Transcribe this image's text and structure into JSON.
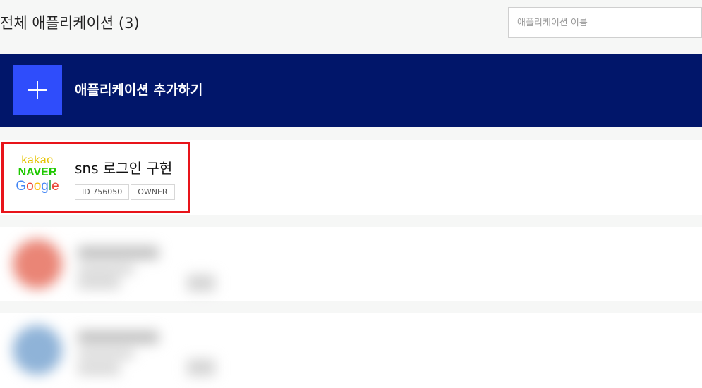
{
  "header": {
    "title": "전체 애플리케이션 (3)",
    "search_placeholder": "애플리케이션 이름"
  },
  "add_app": {
    "label": "애플리케이션 추가하기",
    "icon": "plus-icon"
  },
  "apps": [
    {
      "name": "sns 로그인 구현",
      "logo": {
        "kakao": "kakao",
        "naver": "NAVER",
        "google": [
          "G",
          "o",
          "o",
          "g",
          "l",
          "e"
        ]
      },
      "tags": [
        "ID 756050",
        "OWNER"
      ],
      "highlighted": true
    },
    {
      "blurred": true,
      "avatar_color": "#ea8576"
    },
    {
      "blurred": true,
      "avatar_color": "#8fb3d8"
    }
  ],
  "colors": {
    "add_bar": "#01166a",
    "add_square": "#2f4dfb",
    "highlight_border": "#e8141a",
    "kakao": "#e6c300",
    "naver": "#1ec800",
    "google": [
      "#4285f4",
      "#ea4335",
      "#fbbc05",
      "#4285f4",
      "#34a853",
      "#ea4335"
    ]
  }
}
